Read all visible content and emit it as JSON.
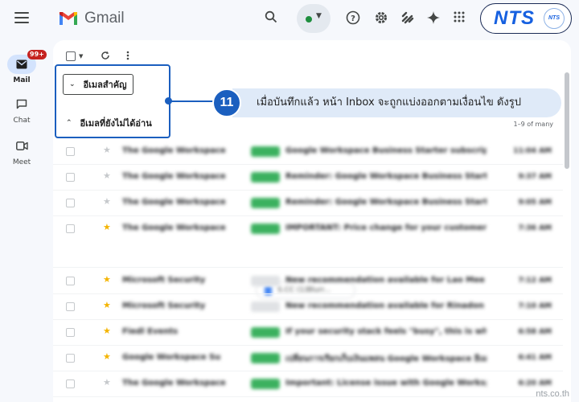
{
  "header": {
    "app_name": "Gmail",
    "brand_name": "NTS",
    "brand_small": "NTS",
    "icons": [
      "menu-icon",
      "search-icon",
      "help-icon",
      "settings-icon",
      "apps-script-icon",
      "gemini-icon",
      "apps-grid-icon"
    ]
  },
  "rail": {
    "mail_label": "Mail",
    "mail_badge": "99+",
    "chat_label": "Chat",
    "meet_label": "Meet"
  },
  "sections": {
    "important_label": "อีเมลสำคัญ",
    "unread_label": "อีเมลที่ยังไม่ได้อ่าน",
    "count_text": "1–9 of many"
  },
  "rows": [
    {
      "sender": "The Google Workspace",
      "subject": "Google Workspace Business Starter subscription",
      "time": "11:04 AM",
      "starred": false,
      "label_color": "#3bb15f"
    },
    {
      "sender": "The Google Workspace",
      "subject": "Reminder: Google Workspace Business Starter",
      "time": "9:37 AM",
      "starred": false,
      "label_color": "#3bb15f"
    },
    {
      "sender": "The Google Workspace",
      "subject": "Reminder: Google Workspace Business Starter",
      "time": "9:05 AM",
      "starred": false,
      "label_color": "#3bb15f"
    },
    {
      "sender": "The Google Workspace",
      "subject": "IMPORTANT: Price change for your customer",
      "time": "7:36 AM",
      "starred": true,
      "label_color": "#3bb15f",
      "attachment": "S.CC (1)Blurr..."
    },
    {
      "sender": "Microsoft Security",
      "subject": "New recommendation available for Lao Mee",
      "time": "7:12 AM",
      "starred": true,
      "label_color": "#e0e2e5"
    },
    {
      "sender": "Microsoft Security",
      "subject": "New recommendation available for Rinadon",
      "time": "7:10 AM",
      "starred": true,
      "label_color": "#e0e2e5"
    },
    {
      "sender": "Fiedl Events",
      "subject": "If your security stack feels \"busy\", this is why",
      "time": "6:58 AM",
      "starred": true,
      "label_color": "#3bb15f"
    },
    {
      "sender": "Google Workspace Su",
      "subject": "เปลี่ยนการเรียกเก็บเงินแพลน Google Workspace อีเมล",
      "time": "6:41 AM",
      "starred": true,
      "label_color": "#3bb15f"
    },
    {
      "sender": "The Google Workspace",
      "subject": "Important: License issue with Google Workspace",
      "time": "6:20 AM",
      "starred": false,
      "label_color": "#3bb15f"
    }
  ],
  "annotation": {
    "step_number": "11",
    "text": "เมื่อบันทึกแล้ว หน้า Inbox จะถูกแบ่งออกตามเงื่อนไข ดังรูป",
    "accent_color": "#1b5fbf"
  },
  "watermark": "nts.co.th"
}
